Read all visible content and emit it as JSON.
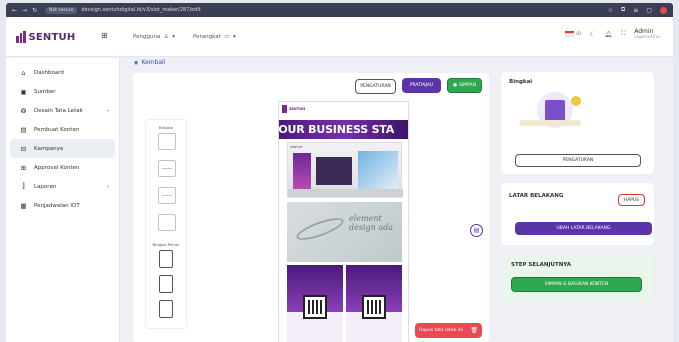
{
  "browser": {
    "not_secure": "Not secure",
    "url": "devsign.sentuhdigital.id/v3/slot_maker/287/edit"
  },
  "brand": {
    "name": "SENTUH"
  },
  "topnav": [
    {
      "label": "Pengguna",
      "icon": "user-icon"
    },
    {
      "label": "Perangkat",
      "icon": "monitor-icon"
    }
  ],
  "topright": {
    "lang": "ID",
    "admin_name": "Admin",
    "admin_role": "superadmin"
  },
  "sidebar": {
    "items": [
      {
        "label": "Dashboard",
        "icon": "home-icon",
        "chevron": false,
        "active": false
      },
      {
        "label": "Sumber",
        "icon": "image-icon",
        "chevron": false,
        "active": false
      },
      {
        "label": "Desain Tata Letak",
        "icon": "layout-icon",
        "chevron": true,
        "active": false
      },
      {
        "label": "Pembuat Konten",
        "icon": "content-icon",
        "chevron": false,
        "active": false
      },
      {
        "label": "Kampanye",
        "icon": "campaign-icon",
        "chevron": false,
        "active": true
      },
      {
        "label": "Approval Konten",
        "icon": "approval-icon",
        "chevron": false,
        "active": false
      },
      {
        "label": "Laporan",
        "icon": "report-icon",
        "chevron": true,
        "active": false
      },
      {
        "label": "Penjadwalan IOT",
        "icon": "calendar-icon",
        "chevron": false,
        "active": false
      }
    ]
  },
  "main": {
    "back_label": "Kembali",
    "buttons": {
      "settings": "PENGATURAN",
      "preview": "PRATINJAU",
      "save": "SIMPAN"
    },
    "tools": {
      "label_frame": "Bingkai",
      "label_full_frame": "Bingkai Penuh"
    },
    "poster": {
      "banner_text": "YOUR BUSINESS STA",
      "logo_text": "SENTUH",
      "sub_logo": "SENTUH",
      "script_text": "element design ada"
    },
    "delete_label": "Hapus tata letak ini"
  },
  "panel": {
    "frame": {
      "title": "Bingkai",
      "button": "PENGATURAN"
    },
    "background": {
      "title": "LATAR BELAKANG",
      "delete": "HAPUS",
      "button": "UBAH LATAR BELAKANG"
    },
    "next": {
      "title": "STEP SELANJUTNYA",
      "button": "SIMPAN & BAGIKAN KONTEN"
    }
  },
  "colors": {
    "brand": "#5a2670",
    "primary": "#5b35a8",
    "success": "#2fa84f",
    "danger": "#e84a55"
  }
}
